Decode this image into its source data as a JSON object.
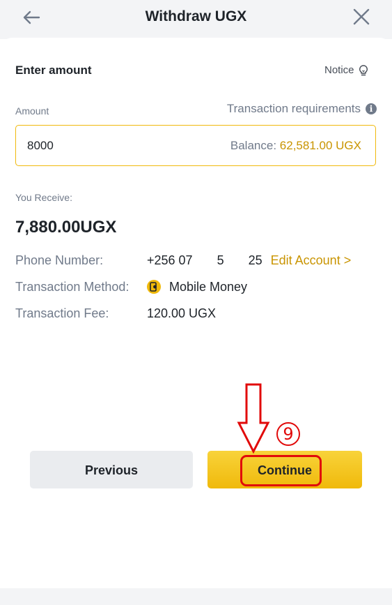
{
  "header": {
    "title": "Withdraw UGX",
    "back_icon": "arrow-left-icon",
    "close_icon": "close-icon"
  },
  "form": {
    "section_title": "Enter amount",
    "notice_label": "Notice",
    "notice_icon": "lightbulb-icon",
    "amount_label": "Amount",
    "requirements_label": "Transaction requirements",
    "requirements_icon": "info-icon",
    "amount_value": "8000",
    "balance_label": "Balance:",
    "balance_value": "62,581.00 UGX"
  },
  "receive": {
    "label": "You Receive:",
    "amount": "7,880.00UGX"
  },
  "details": {
    "phone_label": "Phone Number:",
    "phone_value": "+256 07       5       25",
    "edit_account": "Edit Account >",
    "method_label": "Transaction Method:",
    "method_value": "Mobile Money",
    "method_icon": "mobile-money-icon",
    "fee_label": "Transaction Fee:",
    "fee_value": "120.00 UGX"
  },
  "buttons": {
    "previous": "Previous",
    "continue": "Continue"
  },
  "annotation": {
    "step": "9",
    "color": "#e10a0a"
  },
  "colors": {
    "accent": "#f0b90b",
    "accent_text": "#c99400",
    "muted": "#707a8a",
    "text": "#1e2329"
  }
}
